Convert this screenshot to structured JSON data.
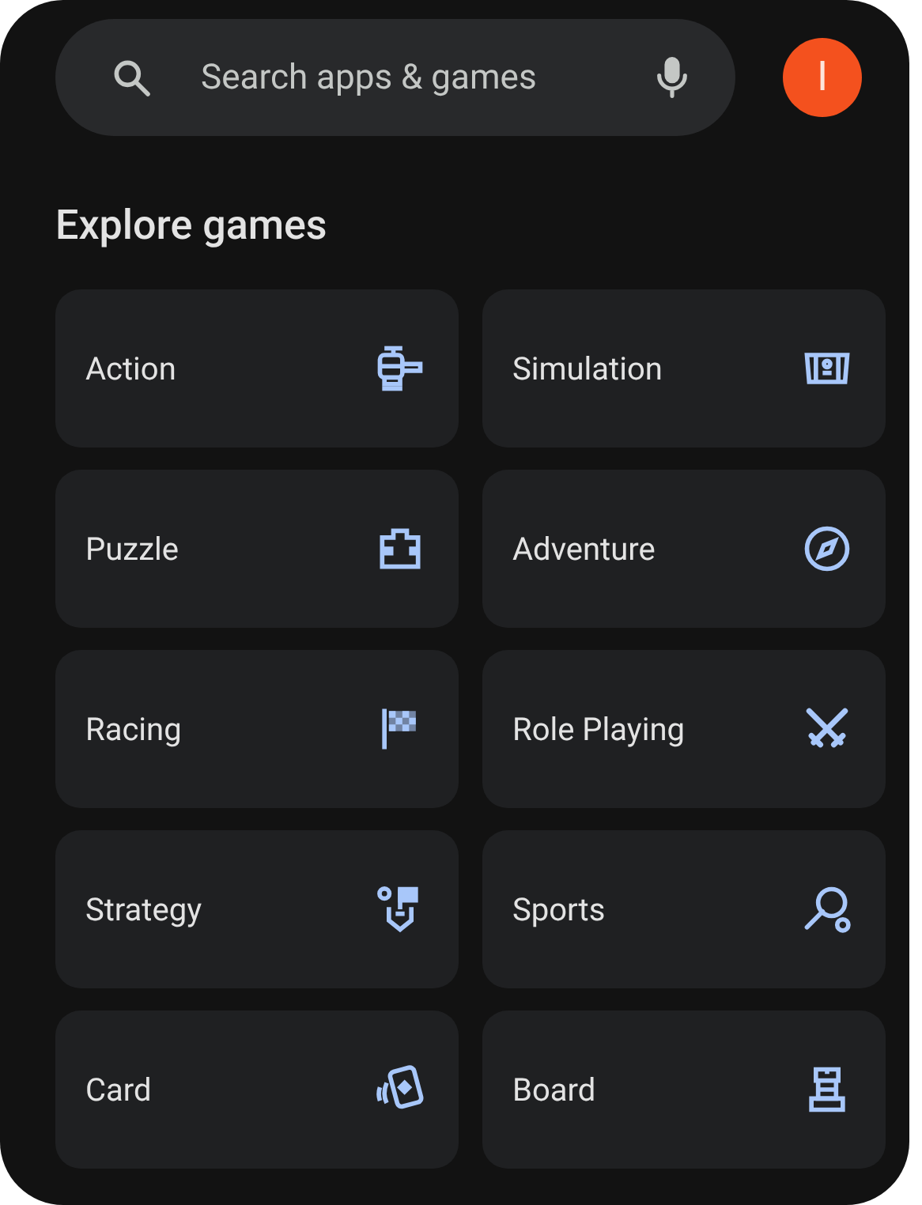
{
  "search": {
    "placeholder": "Search apps & games"
  },
  "avatar": {
    "initial": "I"
  },
  "section": {
    "title": "Explore games"
  },
  "categories": [
    {
      "label": "Action"
    },
    {
      "label": "Simulation"
    },
    {
      "label": "Puzzle"
    },
    {
      "label": "Adventure"
    },
    {
      "label": "Racing"
    },
    {
      "label": "Role Playing"
    },
    {
      "label": "Strategy"
    },
    {
      "label": "Sports"
    },
    {
      "label": "Card"
    },
    {
      "label": "Board"
    }
  ]
}
